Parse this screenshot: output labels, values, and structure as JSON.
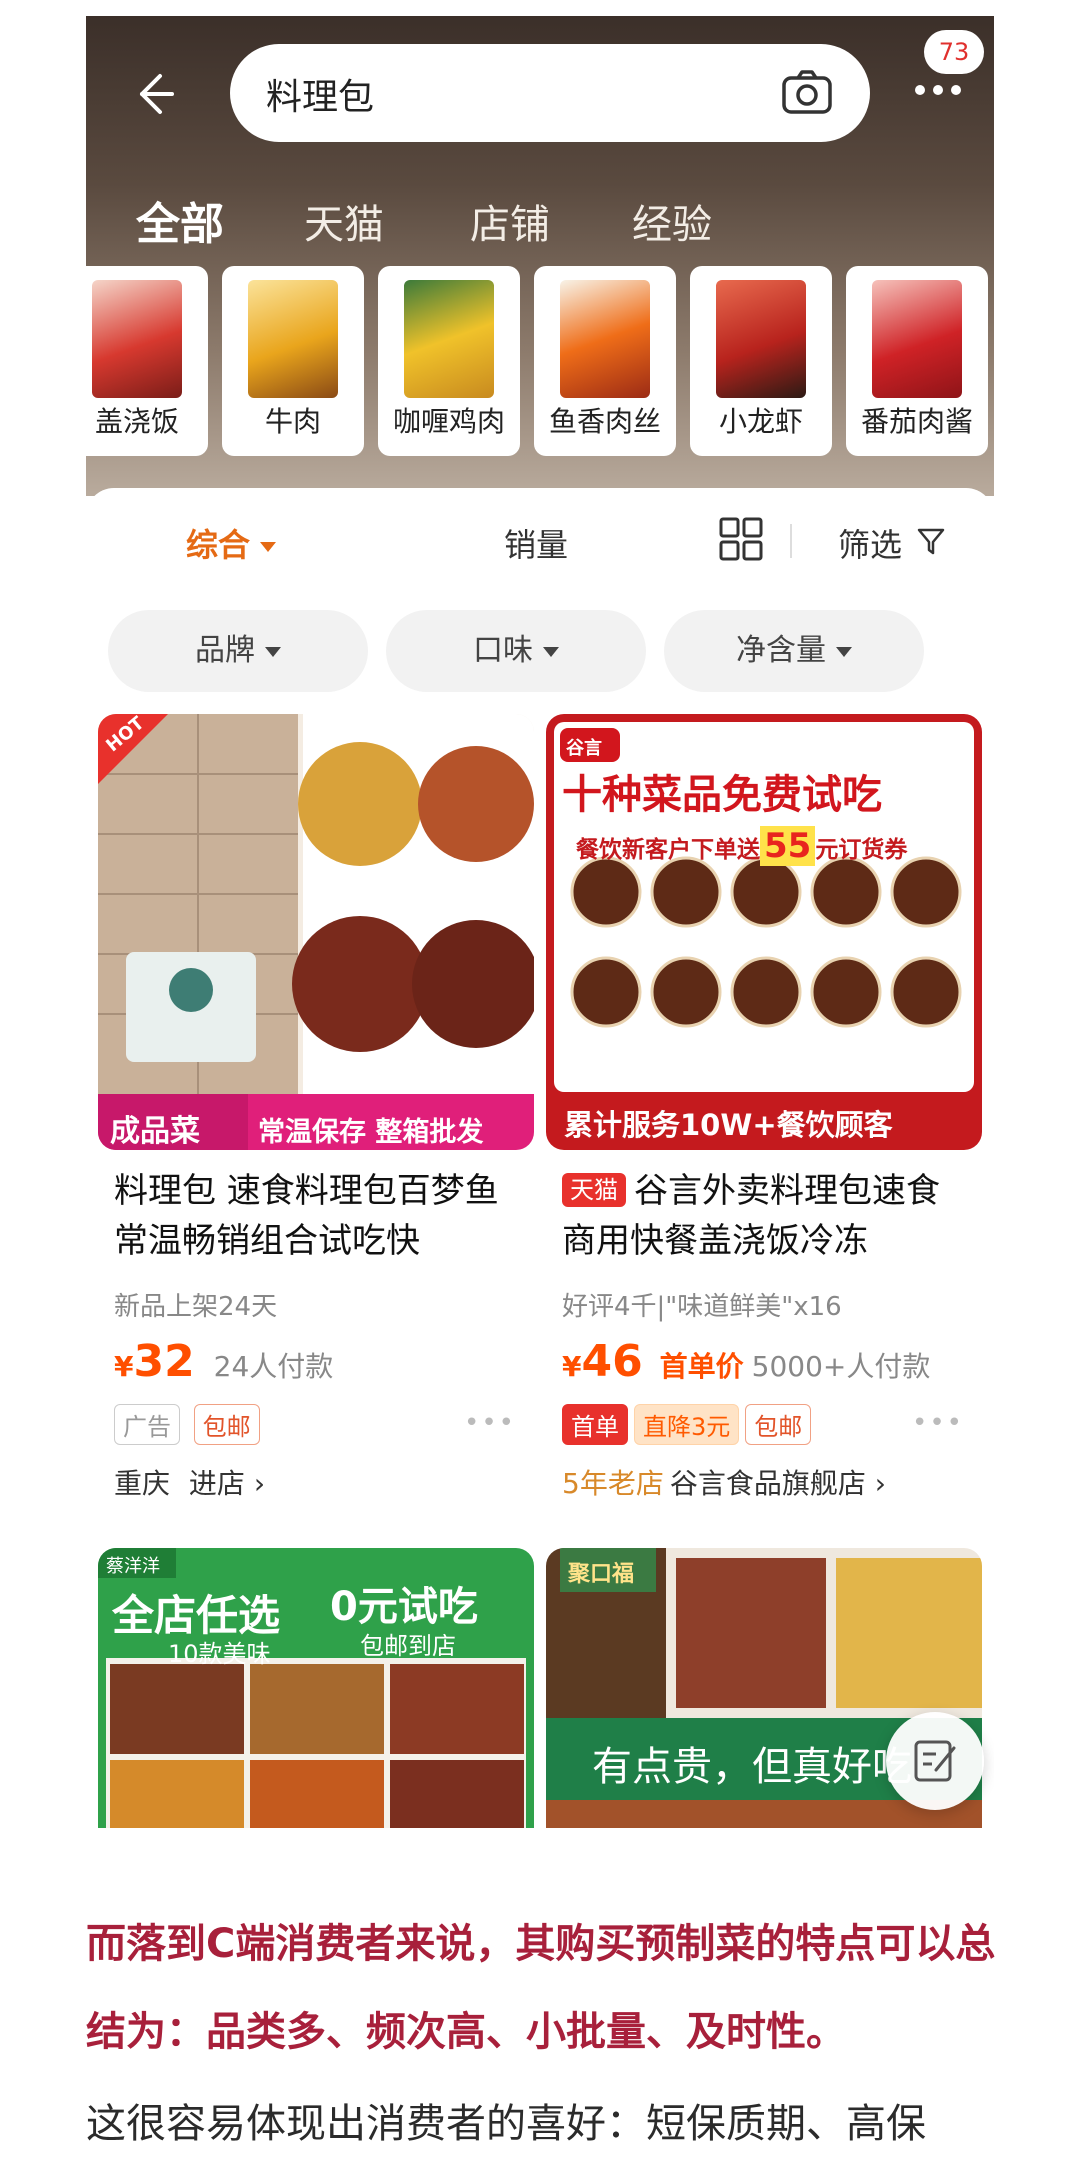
{
  "header": {
    "back_icon": "arrow-left-icon",
    "search_query": "料理包",
    "camera_icon": "camera-icon",
    "more_icon": "more-dots-icon",
    "badge_count": "73"
  },
  "tabs": [
    {
      "label": "全部",
      "active": true
    },
    {
      "label": "天猫",
      "active": false
    },
    {
      "label": "店铺",
      "active": false
    },
    {
      "label": "经验",
      "active": false
    }
  ],
  "categories": [
    {
      "label": "盖浇饭",
      "color": "#d7392f"
    },
    {
      "label": "牛肉",
      "color": "#e9a51c"
    },
    {
      "label": "咖喱鸡肉",
      "color": "#f0c22a"
    },
    {
      "label": "鱼香肉丝",
      "color": "#ef6d18"
    },
    {
      "label": "小龙虾",
      "color": "#b8231d"
    },
    {
      "label": "番茄肉酱",
      "color": "#cf2226"
    }
  ],
  "sort": {
    "active": "综合",
    "sales": "销量",
    "filter": "筛选"
  },
  "chips": [
    "品牌",
    "口味",
    "净含量"
  ],
  "products": [
    {
      "img_badge": "HOT",
      "img_banner_left": "成品菜",
      "img_banner_right": "常温保存 整箱批发",
      "title": "料理包 速食料理包百梦鱼常温畅销组合试吃快",
      "meta": "新品上架24天",
      "price": "32",
      "sales": "24人付款",
      "tags": [
        "广告",
        "包邮"
      ],
      "location": "重庆",
      "shop_link": "进店"
    },
    {
      "tmall": "天猫",
      "img_brand": "谷言",
      "img_headline": "十种菜品免费试吃",
      "img_sub_a": "餐饮新客户下单送",
      "img_sub_num": "55",
      "img_sub_b": "元订货券",
      "img_footer": "累计服务10W+餐饮顾客",
      "title": "谷言外卖料理包速食商用快餐盖浇饭冷冻",
      "meta": "好评4千|\"味道鲜美\"x16",
      "price": "46",
      "first_price": "首单价",
      "sales": "5000+人付款",
      "tags": [
        "首单",
        "直降3元",
        "包邮"
      ],
      "shop_age": "5年老店",
      "shop_name": "谷言食品旗舰店"
    }
  ],
  "products_row2": [
    {
      "brand": "蔡洋洋",
      "headline_a": "全店任选",
      "headline_b": "0元试吃",
      "sub_a": "10款美味",
      "sub_b": "包邮到店"
    },
    {
      "brand": "聚口福",
      "caption": "有点贵，但真好吃"
    }
  ],
  "fab_icon": "edit-note-icon",
  "article": {
    "para1": "而落到C端消费者来说，其购买预制菜的特点可以总结为：品类多、频次高、小批量、及时性。",
    "para2": "这很容易体现出消费者的喜好：短保质期、高保"
  }
}
